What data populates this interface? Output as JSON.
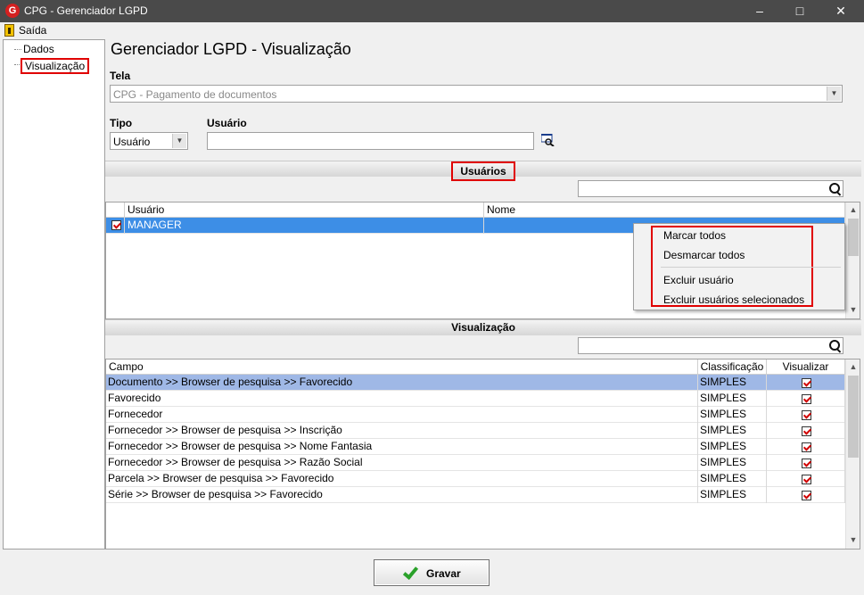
{
  "window": {
    "title": "CPG - Gerenciador LGPD",
    "icon": "app-logo-icon"
  },
  "menu": {
    "exit_label": "Saída"
  },
  "tree": {
    "items": [
      "Dados",
      "Visualização"
    ],
    "selected": "Visualização"
  },
  "page": {
    "heading": "Gerenciador LGPD - Visualização"
  },
  "tela": {
    "label": "Tela",
    "value": "CPG - Pagamento de documentos"
  },
  "tipo": {
    "label": "Tipo",
    "value": "Usuário"
  },
  "usuario": {
    "label": "Usuário",
    "value": ""
  },
  "usuarios_section": {
    "title": "Usuários",
    "search_value": "",
    "columns": [
      "Usuário",
      "Nome"
    ],
    "rows": [
      {
        "checked": true,
        "usuario": "MANAGER",
        "nome": ""
      }
    ]
  },
  "context_menu": {
    "items": [
      "Marcar todos",
      "Desmarcar todos",
      "Excluir usuário",
      "Excluir usuários selecionados"
    ]
  },
  "visualizacao_section": {
    "title": "Visualização",
    "search_value": "",
    "columns": [
      "Campo",
      "Classificação",
      "Visualizar"
    ],
    "rows": [
      {
        "campo": "Documento >> Browser de pesquisa >> Favorecido",
        "classificacao": "SIMPLES",
        "visualizar": true
      },
      {
        "campo": "Favorecido",
        "classificacao": "SIMPLES",
        "visualizar": true
      },
      {
        "campo": "Fornecedor",
        "classificacao": "SIMPLES",
        "visualizar": true
      },
      {
        "campo": "Fornecedor >> Browser de pesquisa >> Inscrição",
        "classificacao": "SIMPLES",
        "visualizar": true
      },
      {
        "campo": "Fornecedor >> Browser de pesquisa >> Nome Fantasia",
        "classificacao": "SIMPLES",
        "visualizar": true
      },
      {
        "campo": "Fornecedor >> Browser de pesquisa >> Razão Social",
        "classificacao": "SIMPLES",
        "visualizar": true
      },
      {
        "campo": "Parcela >> Browser de pesquisa >> Favorecido",
        "classificacao": "SIMPLES",
        "visualizar": true
      },
      {
        "campo": "Série >> Browser de pesquisa >> Favorecido",
        "classificacao": "SIMPLES",
        "visualizar": true
      }
    ]
  },
  "footer": {
    "save_label": "Gravar"
  },
  "colors": {
    "title_bar": "#4a4a4a",
    "selection": "#3d8ee6",
    "selection_light": "#9fb8e6",
    "highlight_box": "#e00000"
  }
}
